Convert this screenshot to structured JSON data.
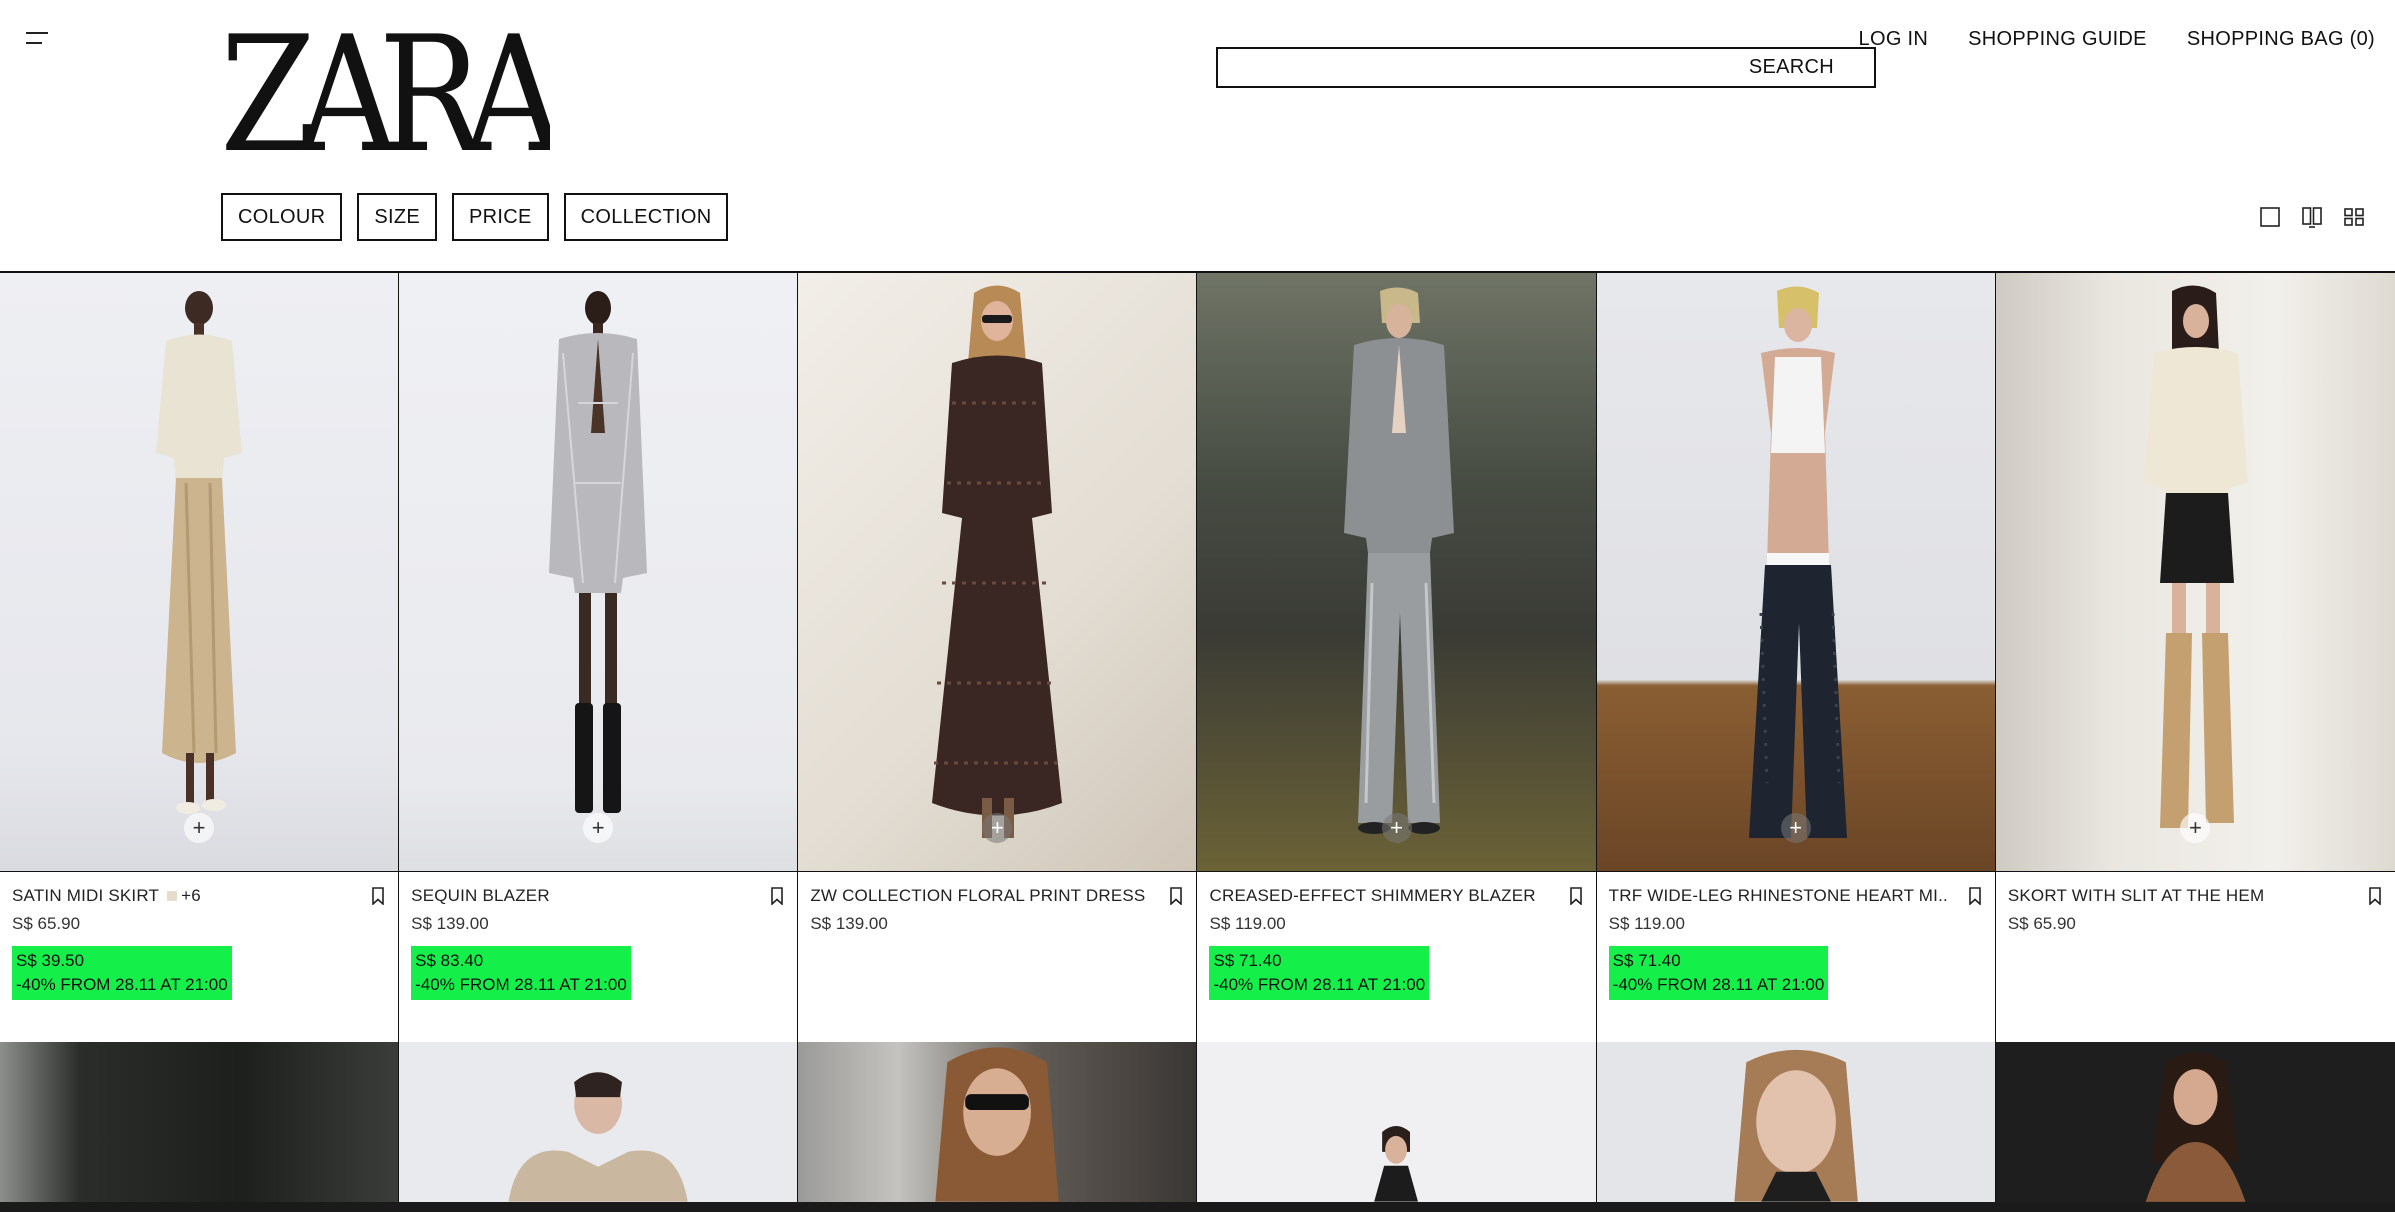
{
  "header": {
    "brand": "ZARA",
    "search_label": "SEARCH",
    "links": [
      "LOG IN",
      "SHOPPING GUIDE",
      "SHOPPING BAG (0)"
    ]
  },
  "filters": [
    "COLOUR",
    "SIZE",
    "PRICE",
    "COLLECTION"
  ],
  "products": [
    {
      "name": "SATIN MIDI SKIRT",
      "extra_colours": "+6",
      "price": "S$ 65.90",
      "sale_price": "S$ 39.50",
      "sale_note": "-40% FROM 28.11 AT 21:00"
    },
    {
      "name": "SEQUIN BLAZER",
      "price": "S$ 139.00",
      "sale_price": "S$ 83.40",
      "sale_note": "-40% FROM 28.11 AT 21:00"
    },
    {
      "name": "ZW COLLECTION FLORAL PRINT DRESS",
      "price": "S$ 139.00"
    },
    {
      "name": "CREASED-EFFECT SHIMMERY BLAZER",
      "price": "S$ 119.00",
      "sale_price": "S$ 71.40",
      "sale_note": "-40% FROM 28.11 AT 21:00"
    },
    {
      "name": "TRF WIDE-LEG RHINESTONE HEART MI...",
      "price": "S$ 119.00",
      "sale_price": "S$ 71.40",
      "sale_note": "-40% FROM 28.11 AT 21:00"
    },
    {
      "name": "SKORT WITH SLIT AT THE HEM",
      "price": "S$ 65.90"
    }
  ],
  "colors": {
    "sale_highlight": "#14f049",
    "text": "#111111",
    "border": "#111111"
  }
}
